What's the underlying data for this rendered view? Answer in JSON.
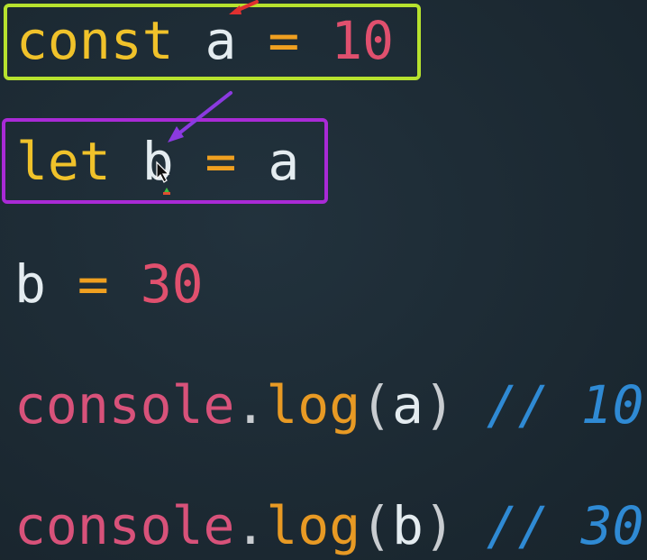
{
  "code": {
    "line1": {
      "keyword": "const",
      "name": "a",
      "op": "=",
      "value": "10"
    },
    "line2": {
      "keyword": "let",
      "name": "b",
      "op": "=",
      "value": "a"
    },
    "line3": {
      "name": "b",
      "op": "=",
      "value": "30"
    },
    "line4": {
      "object": "console",
      "dot": ".",
      "method": "log",
      "open": "(",
      "arg": "a",
      "close": ")",
      "comment": "// 10"
    },
    "line5": {
      "object": "console",
      "dot": ".",
      "method": "log",
      "open": "(",
      "arg": "b",
      "close": ")",
      "comment": "// 30"
    }
  },
  "colors": {
    "background": "#1d2b35",
    "keyword": "#f0c22a",
    "identifier": "#e4ecf0",
    "operator": "#f0a020",
    "number": "#e0506e",
    "comment": "#2f8ad4",
    "highlight_green": "#b7e22e",
    "highlight_purple": "#a92ad6",
    "annotation_arrow_red": "#e03030",
    "annotation_arrow_purple": "#8b3ae0"
  }
}
